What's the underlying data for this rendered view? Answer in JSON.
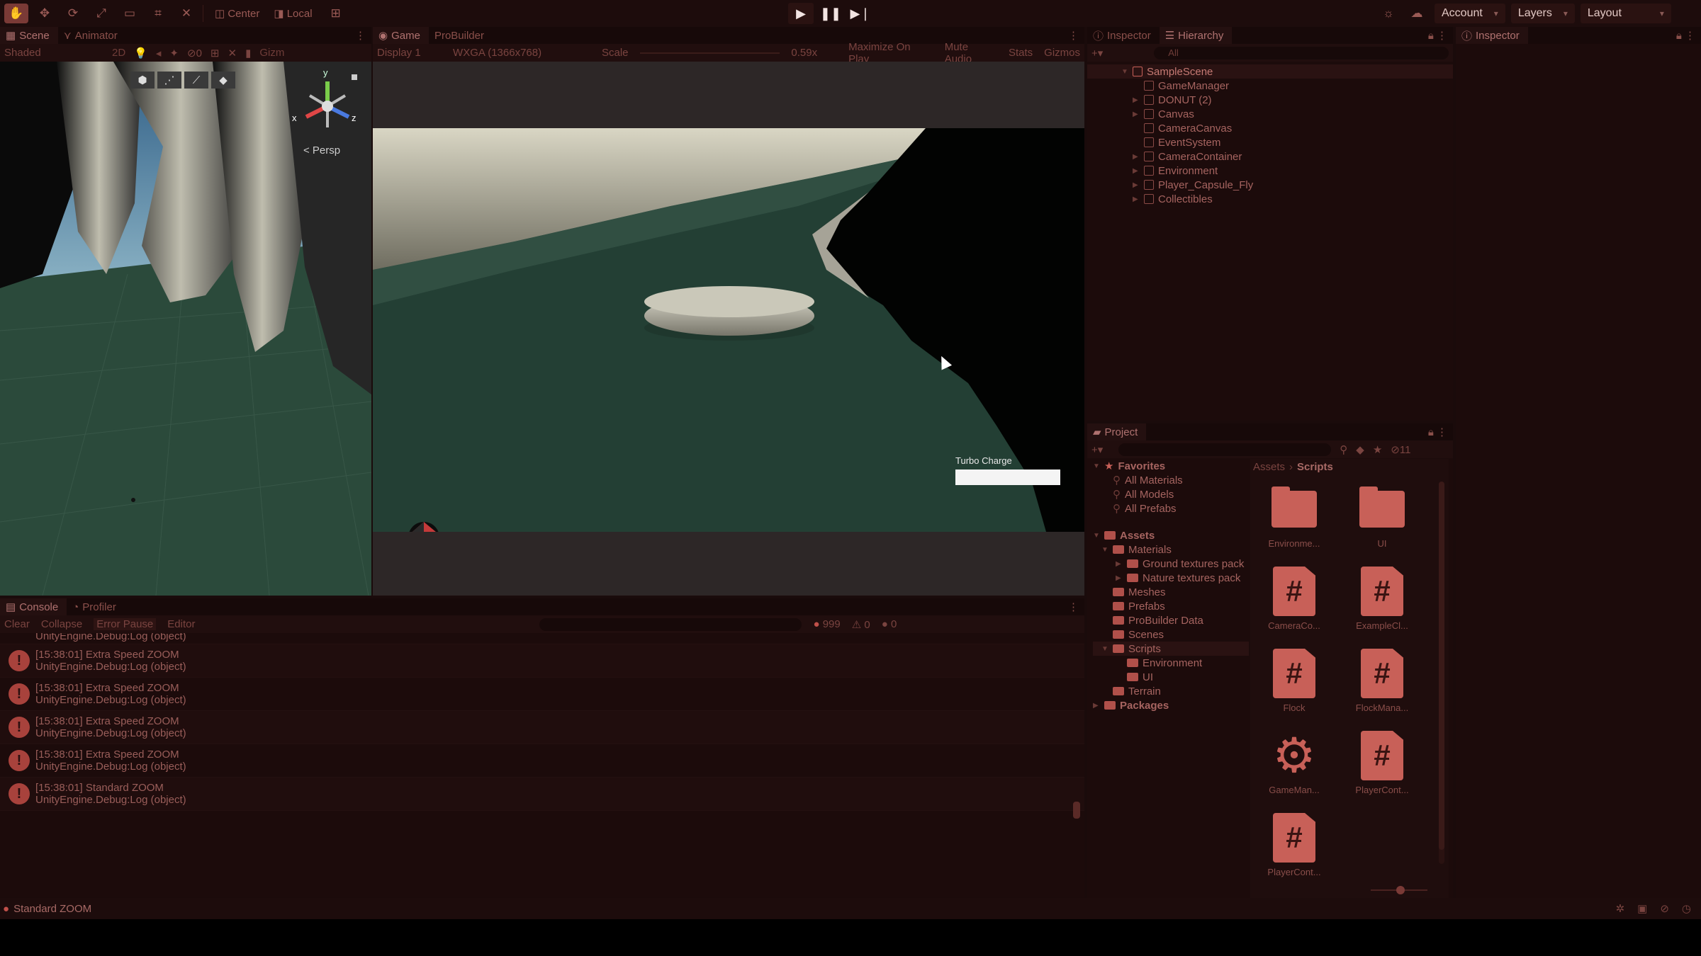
{
  "toolbar": {
    "pivot_label": "Center",
    "space_label": "Local",
    "account_label": "Account",
    "layers_label": "Layers",
    "layout_label": "Layout"
  },
  "scene_panel": {
    "tabs": [
      "Scene",
      "Animator"
    ],
    "shading_mode": "Shaded",
    "toggle_2d": "2D",
    "gizmo_count": "0",
    "gizmos_short": "Gizm",
    "persp_label": "< Persp",
    "axis_labels": [
      "y",
      "x",
      "z"
    ]
  },
  "game_panel": {
    "tabs": [
      "Game",
      "ProBuilder"
    ],
    "display": "Display 1",
    "resolution": "WXGA (1366x768)",
    "scale_label": "Scale",
    "scale_value": "0.59x",
    "maximize": "Maximize On Play",
    "mute": "Mute Audio",
    "stats": "Stats",
    "gizmos": "Gizmos",
    "turbo_label": "Turbo Charge",
    "turbo_level": 1.0
  },
  "hierarchy": {
    "tabs": [
      "Inspector",
      "Hierarchy"
    ],
    "search_placeholder": "All",
    "scene_name": "SampleScene",
    "items": [
      {
        "label": "GameManager",
        "expandable": false
      },
      {
        "label": "DONUT (2)",
        "expandable": true
      },
      {
        "label": "Canvas",
        "expandable": true
      },
      {
        "label": "CameraCanvas",
        "expandable": false
      },
      {
        "label": "EventSystem",
        "expandable": false
      },
      {
        "label": "CameraContainer",
        "expandable": true
      },
      {
        "label": "Environment",
        "expandable": true
      },
      {
        "label": "Player_Capsule_Fly",
        "expandable": true
      },
      {
        "label": "Collectibles",
        "expandable": true
      }
    ]
  },
  "inspector": {
    "tab": "Inspector"
  },
  "console": {
    "tabs": [
      "Console",
      "Profiler"
    ],
    "clear": "Clear",
    "collapse": "Collapse",
    "error_pause": "Error Pause",
    "editor": "Editor",
    "err_count": "999",
    "warn_count": "0",
    "info_count": "0",
    "partial_entry": "UnityEngine.Debug:Log (object)",
    "entries": [
      {
        "line1": "[15:38:01] Extra Speed ZOOM",
        "line2": "UnityEngine.Debug:Log (object)"
      },
      {
        "line1": "[15:38:01] Extra Speed ZOOM",
        "line2": "UnityEngine.Debug:Log (object)"
      },
      {
        "line1": "[15:38:01] Extra Speed ZOOM",
        "line2": "UnityEngine.Debug:Log (object)"
      },
      {
        "line1": "[15:38:01] Extra Speed ZOOM",
        "line2": "UnityEngine.Debug:Log (object)"
      },
      {
        "line1": "[15:38:01] Standard ZOOM",
        "line2": "UnityEngine.Debug:Log (object)"
      }
    ]
  },
  "project": {
    "tab": "Project",
    "hidden_count": "11",
    "breadcrumb_root": "Assets",
    "breadcrumb_current": "Scripts",
    "favorites_label": "Favorites",
    "favorites": [
      "All Materials",
      "All Models",
      "All Prefabs"
    ],
    "assets_label": "Assets",
    "tree": [
      {
        "label": "Materials",
        "level": 1
      },
      {
        "label": "Ground textures pack",
        "level": 2
      },
      {
        "label": "Nature textures pack",
        "level": 2
      },
      {
        "label": "Meshes",
        "level": 1
      },
      {
        "label": "Prefabs",
        "level": 1
      },
      {
        "label": "ProBuilder Data",
        "level": 1
      },
      {
        "label": "Scenes",
        "level": 1
      },
      {
        "label": "Scripts",
        "level": 1
      },
      {
        "label": "Environment",
        "level": 2
      },
      {
        "label": "UI",
        "level": 2
      },
      {
        "label": "Terrain",
        "level": 1
      }
    ],
    "packages_label": "Packages",
    "assets": [
      {
        "label": "Environme...",
        "kind": "folder"
      },
      {
        "label": "UI",
        "kind": "folder"
      },
      {
        "label": "CameraCo...",
        "kind": "script"
      },
      {
        "label": "ExampleCl...",
        "kind": "script"
      },
      {
        "label": "Flock",
        "kind": "script"
      },
      {
        "label": "FlockMana...",
        "kind": "script"
      },
      {
        "label": "GameMan...",
        "kind": "gear"
      },
      {
        "label": "PlayerCont...",
        "kind": "script"
      },
      {
        "label": "PlayerCont...",
        "kind": "script"
      }
    ]
  },
  "status_bar": {
    "message": "Standard ZOOM"
  },
  "colors": {
    "accent": "#c86058",
    "error": "#a8423c",
    "panel_bg": "#1c0b0b",
    "game_ground": "#2a4a3e"
  }
}
